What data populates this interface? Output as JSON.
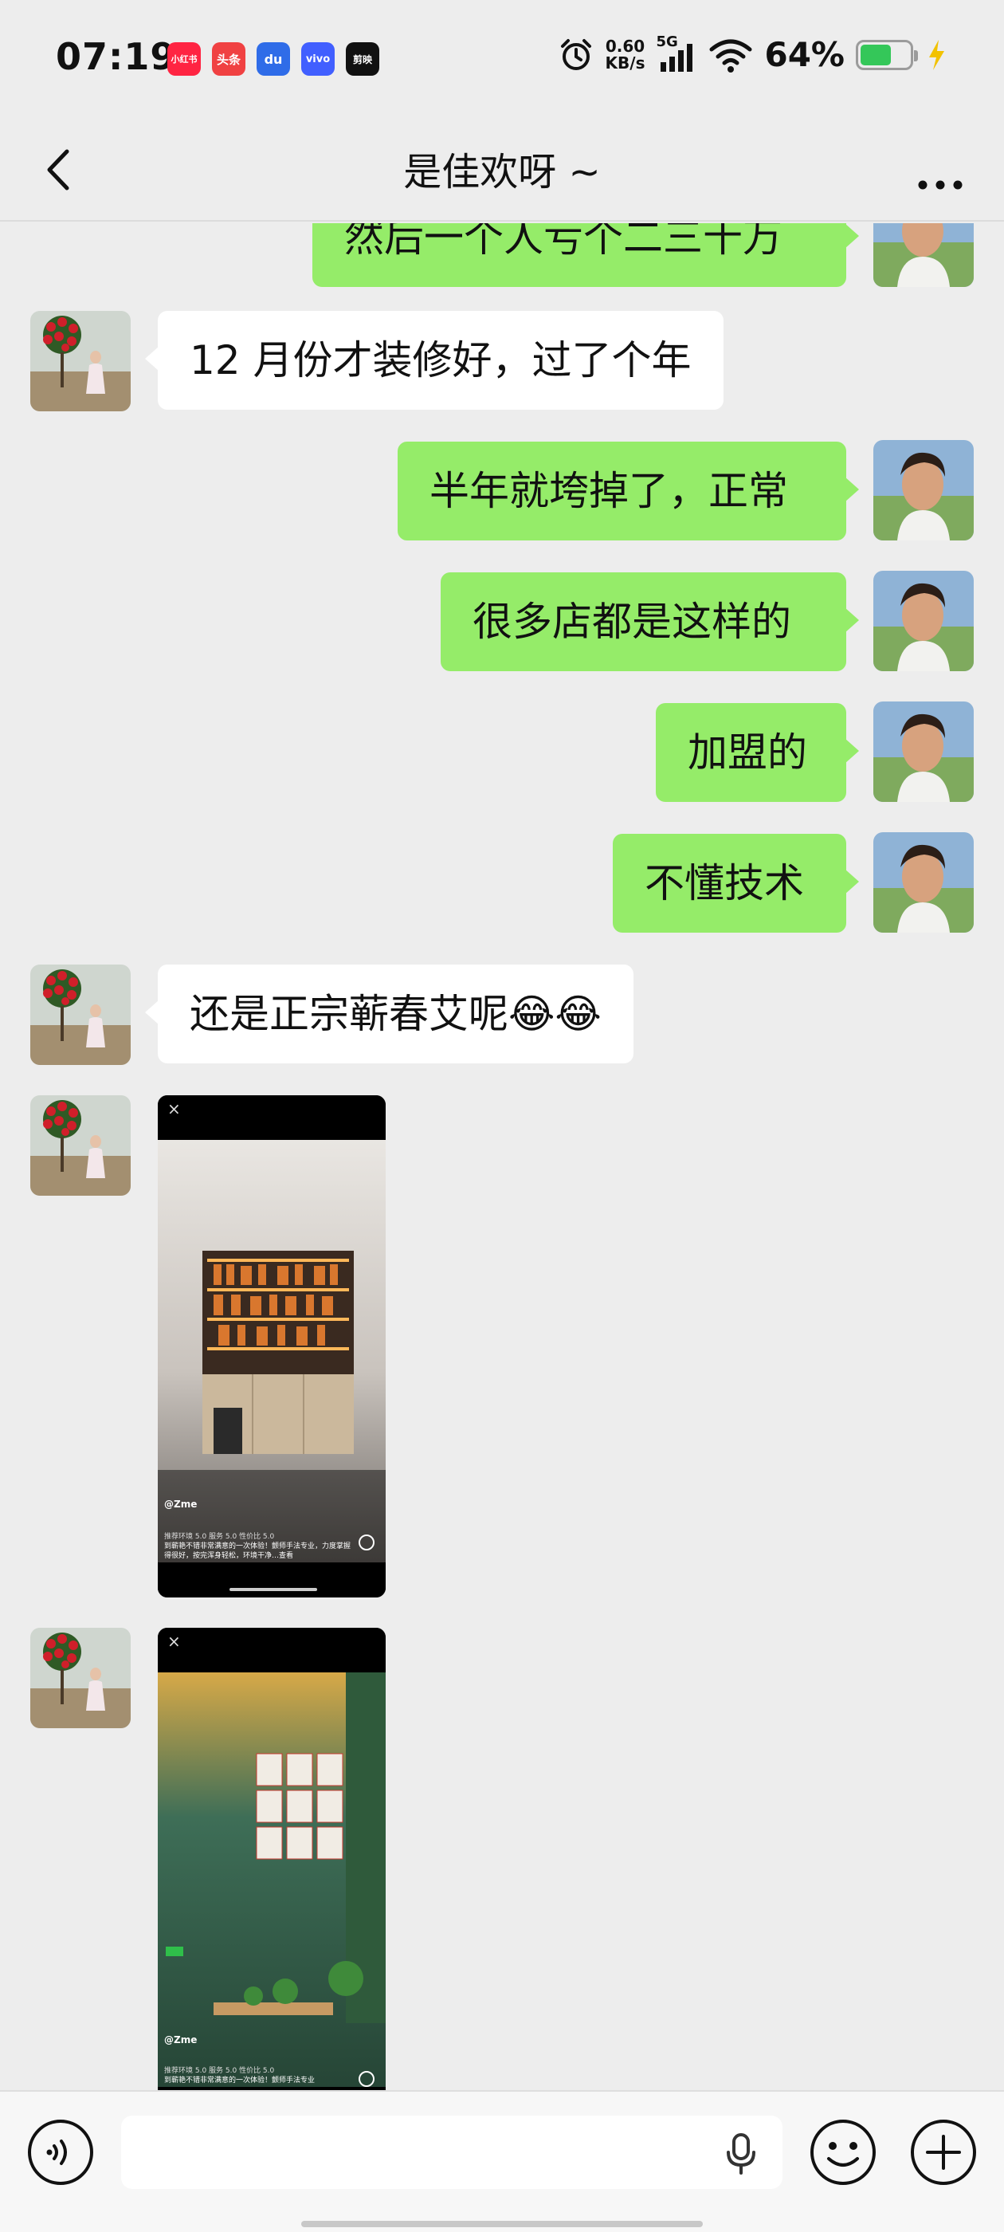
{
  "status_bar": {
    "time": "07:19",
    "apps": [
      {
        "label": "小红书",
        "color": "#ff2442"
      },
      {
        "label": "头条",
        "color": "#f04142"
      },
      {
        "label": "du",
        "color": "#2f6ce8"
      },
      {
        "label": "vivo",
        "color": "#415fff"
      },
      {
        "label": "剪映",
        "color": "#111111"
      }
    ],
    "net_speed_value": "0.60",
    "net_speed_unit": "KB/s",
    "signal_label": "5G",
    "battery_percent_text": "64%",
    "battery_level": 0.64,
    "icons": [
      "alarm-icon",
      "signal-icon",
      "wifi-icon",
      "battery-icon",
      "charging-icon"
    ]
  },
  "nav": {
    "title": "是佳欢呀 ~",
    "back_icon": "chevron-left-icon",
    "more_icon": "more-icon"
  },
  "messages": [
    {
      "side": "me",
      "text": "然后一个人亏个二三十万"
    },
    {
      "side": "them",
      "text": "12 月份才装修好，过了个年"
    },
    {
      "side": "me",
      "text": "半年就垮掉了，正常"
    },
    {
      "side": "me",
      "text": "很多店都是这样的"
    },
    {
      "side": "me",
      "text": "加盟的"
    },
    {
      "side": "me",
      "text": "不懂技术"
    },
    {
      "side": "them",
      "text": "还是正宗蕲春艾呢😂😂"
    },
    {
      "side": "them",
      "type": "video",
      "author": "@Zme",
      "caption": "到蕲艳不错非常满意的一次体验！颤师手法专业，力度掌握得很好，按完浑身轻松，环境干净…查看",
      "stats": "推荐环境 5.0  服务 5.0  性价比 5.0"
    },
    {
      "side": "them",
      "type": "video",
      "author": "@Zme",
      "caption": "到蕲艳不错非常满意的一次体验！颤师手法专业",
      "stats": "推荐环境 5.0  服务 5.0  性价比 5.0"
    }
  ],
  "input_bar": {
    "placeholder": "",
    "icons": [
      "voice-icon",
      "mic-icon",
      "emoji-icon",
      "plus-icon"
    ]
  },
  "colors": {
    "background": "#ededed",
    "bubble_me": "#95ec69",
    "bubble_them": "#ffffff"
  }
}
